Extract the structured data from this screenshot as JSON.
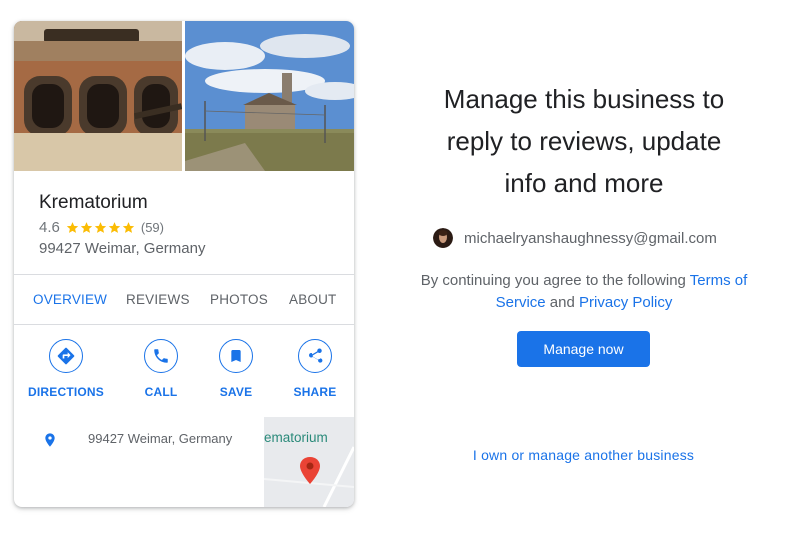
{
  "business_card": {
    "name": "Krematorium",
    "rating": "4.6",
    "rating_value": 4.6,
    "review_count": "(59)",
    "address": "99427 Weimar, Germany",
    "tabs": [
      {
        "label": "OVERVIEW",
        "active": true
      },
      {
        "label": "REVIEWS",
        "active": false
      },
      {
        "label": "PHOTOS",
        "active": false
      },
      {
        "label": "ABOUT",
        "active": false
      }
    ],
    "actions": [
      {
        "label": "DIRECTIONS",
        "icon": "directions-icon"
      },
      {
        "label": "CALL",
        "icon": "phone-icon"
      },
      {
        "label": "SAVE",
        "icon": "bookmark-icon"
      },
      {
        "label": "SHARE",
        "icon": "share-icon"
      }
    ],
    "location_address": "99427 Weimar, Germany",
    "map_label": "ematorium"
  },
  "panel": {
    "headline_lines": [
      "Manage this business to",
      "reply to reviews, update",
      "info and more"
    ],
    "account_email": "michaelryanshaughnessy@gmail.com",
    "terms_prefix": "By continuing you agree to the following ",
    "terms_link": "Terms of Service",
    "terms_and": " and ",
    "privacy_link": "Privacy Policy",
    "manage_button": "Manage now",
    "other_business_link": "I own or manage another business"
  },
  "colors": {
    "accent": "#1a73e8",
    "star": "#fbbc04",
    "pin_red": "#ea4335"
  }
}
